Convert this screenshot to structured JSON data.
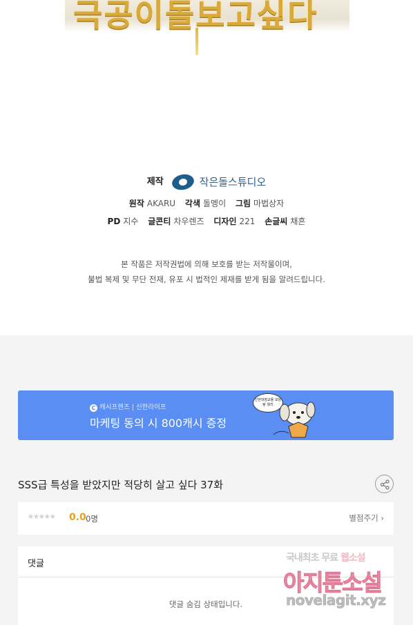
{
  "title_art_text": "극공이돌보고싶다",
  "credits": {
    "production_label": "제작",
    "studio": "작은돌스튜디오",
    "original_label": "원작",
    "original": "AKARU",
    "adaptation_label": "각색",
    "adaptation": "돌멩이",
    "art_label": "그림",
    "art": "마법상자",
    "pd_label": "PD",
    "pd": "지수",
    "conti_label": "글콘티",
    "conti": "차우렌즈",
    "design_label": "디자인",
    "design": "221",
    "lettering_label": "손글씨",
    "lettering": "채흔"
  },
  "copyright": {
    "line1": "본 작품은 저작권법에 의해 보호를 받는 저작물이며,",
    "line2": "불법 복제 및 무단 전재, 유포 시 법적인 제재를 받게 됨을 알려드립니다."
  },
  "banner": {
    "brand_icon": "C",
    "brand": "캐시프렌즈 | 신한라이프",
    "promo": "마케팅 동의 시 800캐시 증정",
    "bubble": "신한대장교들 모양탕 월리",
    "color": "#5b8ef2"
  },
  "episode": {
    "title": "SSS급 특성을 받았지만 적당히 살고 싶다 37화",
    "share_icon": "share-icon"
  },
  "rating": {
    "stars": "★★★★★",
    "score": "0.0",
    "count": "0명",
    "rate_button": "별점주기",
    "score_color": "#e5a11b"
  },
  "comments": {
    "header": "댓글",
    "hidden_message": "댓글 숨김 상태입니다."
  },
  "watermark": {
    "line1_a": "국내최초 무료 ",
    "line1_b": "웹소설",
    "line2": "아지툰소설",
    "line3": "novelagit.xyz"
  }
}
